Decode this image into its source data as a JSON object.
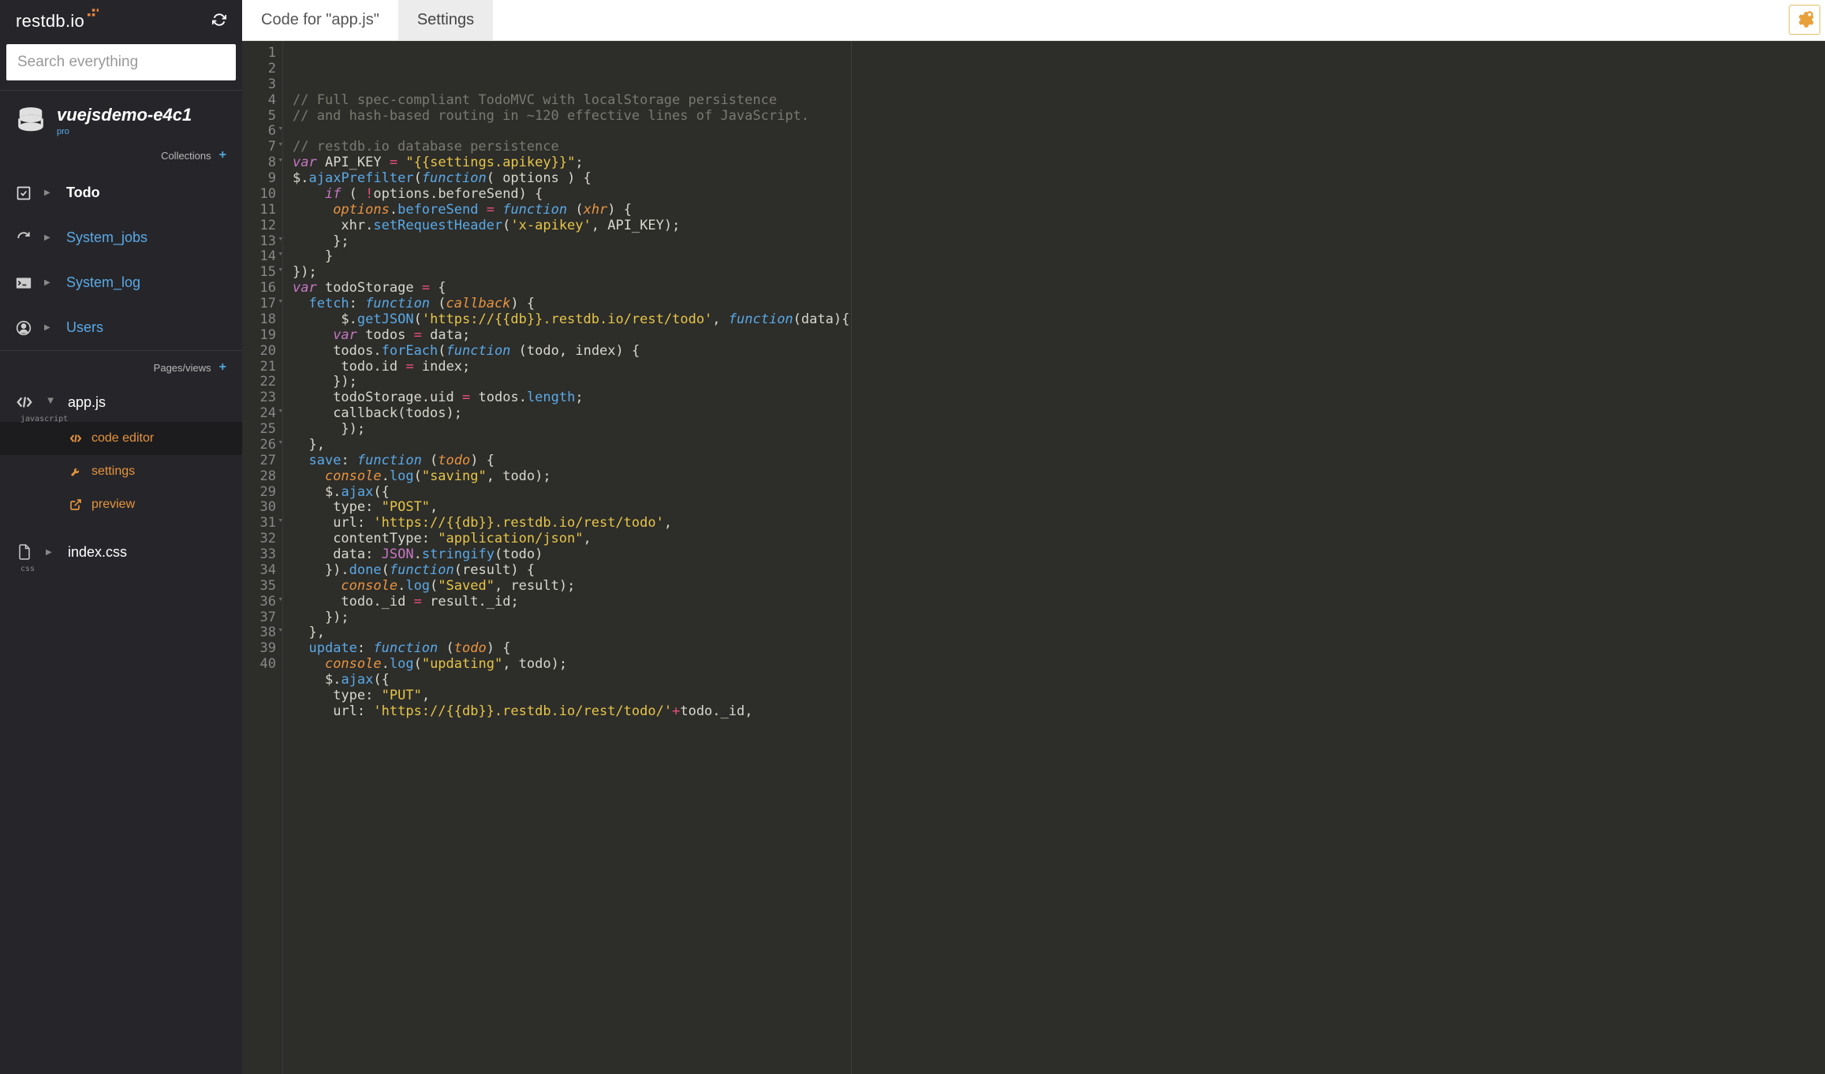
{
  "brand": "restdb.io",
  "search": {
    "placeholder": "Search everything"
  },
  "db": {
    "name": "vuejsdemo-e4c1",
    "plan": "pro"
  },
  "sections": {
    "collections": {
      "label": "Collections"
    },
    "pages": {
      "label": "Pages/views"
    }
  },
  "nav": {
    "todo": "Todo",
    "system_jobs": "System_jobs",
    "system_log": "System_log",
    "users": "Users"
  },
  "files": {
    "appjs": {
      "name": "app.js",
      "type": "javascript"
    },
    "indexcss": {
      "name": "index.css",
      "type": "css"
    }
  },
  "subitems": {
    "code_editor": "code editor",
    "settings": "settings",
    "preview": "preview"
  },
  "tabs": {
    "code": "Code for \"app.js\"",
    "settings": "Settings"
  },
  "editor": {
    "line_numbers": [
      "1",
      "2",
      "3",
      "4",
      "5",
      "6",
      "7",
      "8",
      "9",
      "10",
      "11",
      "12",
      "13",
      "14",
      "15",
      "16",
      "17",
      "18",
      "19",
      "20",
      "21",
      "22",
      "23",
      "24",
      "25",
      "26",
      "27",
      "28",
      "29",
      "30",
      "31",
      "32",
      "33",
      "34",
      "35",
      "36",
      "37",
      "38",
      "39",
      "40"
    ],
    "fold_lines": [
      6,
      7,
      8,
      13,
      14,
      15,
      17,
      24,
      26,
      31,
      36,
      38
    ],
    "lines_html": [
      "<span class='c-comment'>// Full spec-compliant TodoMVC with localStorage persistence</span>",
      "<span class='c-comment'>// and hash-based routing in ~120 effective lines of JavaScript.</span>",
      "",
      "<span class='c-comment'>// restdb.io database persistence</span>",
      "<span class='c-kw'>var</span> <span class='c-obj'>API_KEY</span> <span class='c-op'>=</span> <span class='c-str'>\"{{settings.apikey}}\"</span>;",
      "<span class='c-obj'>$</span>.<span class='c-method'>ajaxPrefilter</span>(<span class='c-func'>function</span>( <span class='c-obj'>options</span> ) {",
      "    <span class='c-kw'>if</span> ( <span class='c-op'>!</span><span class='c-obj'>options</span>.<span class='c-obj'>beforeSend</span>) {",
      "     <span class='c-param'>options</span>.<span class='c-method'>beforeSend</span> <span class='c-op'>=</span> <span class='c-func'>function</span> (<span class='c-param'>xhr</span>) {",
      "      <span class='c-obj'>xhr</span>.<span class='c-method'>setRequestHeader</span>(<span class='c-str'>'x-apikey'</span>, <span class='c-obj'>API_KEY</span>);",
      "     };",
      "    }",
      "});",
      "<span class='c-kw'>var</span> <span class='c-obj'>todoStorage</span> <span class='c-op'>=</span> {",
      "  <span class='c-prop'>fetch</span>: <span class='c-func'>function</span> (<span class='c-param'>callback</span>) {",
      "      <span class='c-obj'>$</span>.<span class='c-method'>getJSON</span>(<span class='c-str'>'https://{{db}}.restdb.io/rest/todo'</span>, <span class='c-func'>function</span>(<span class='c-obj'>data</span>){",
      "     <span class='c-kw'>var</span> <span class='c-obj'>todos</span> <span class='c-op'>=</span> <span class='c-obj'>data</span>;",
      "     <span class='c-obj'>todos</span>.<span class='c-method'>forEach</span>(<span class='c-func'>function</span> (<span class='c-obj'>todo</span>, <span class='c-obj'>index</span>) {",
      "      <span class='c-obj'>todo</span>.<span class='c-obj'>id</span> <span class='c-op'>=</span> <span class='c-obj'>index</span>;",
      "     });",
      "     <span class='c-obj'>todoStorage</span>.<span class='c-obj'>uid</span> <span class='c-op'>=</span> <span class='c-obj'>todos</span>.<span class='c-prop'>length</span>;",
      "     <span class='c-obj'>callback</span>(<span class='c-obj'>todos</span>);",
      "      });",
      "  },",
      "  <span class='c-prop'>save</span>: <span class='c-func'>function</span> (<span class='c-param'>todo</span>) {",
      "    <span class='c-param'>console</span>.<span class='c-method'>log</span>(<span class='c-str'>\"saving\"</span>, <span class='c-obj'>todo</span>);",
      "    <span class='c-obj'>$</span>.<span class='c-method'>ajax</span>({",
      "     <span class='c-obj'>type</span>: <span class='c-str'>\"POST\"</span>,",
      "     <span class='c-obj'>url</span>: <span class='c-str'>'https://{{db}}.restdb.io/rest/todo'</span>,",
      "     <span class='c-obj'>contentType</span>: <span class='c-str'>\"application/json\"</span>,",
      "     <span class='c-obj'>data</span>: <span class='c-const'>JSON</span>.<span class='c-method'>stringify</span>(<span class='c-obj'>todo</span>)",
      "    }).<span class='c-method'>done</span>(<span class='c-func'>function</span>(<span class='c-obj'>result</span>) {",
      "      <span class='c-param'>console</span>.<span class='c-method'>log</span>(<span class='c-str'>\"Saved\"</span>, <span class='c-obj'>result</span>);",
      "      <span class='c-obj'>todo</span>.<span class='c-obj'>_id</span> <span class='c-op'>=</span> <span class='c-obj'>result</span>.<span class='c-obj'>_id</span>;",
      "    });",
      "  },",
      "  <span class='c-prop'>update</span>: <span class='c-func'>function</span> (<span class='c-param'>todo</span>) {",
      "    <span class='c-param'>console</span>.<span class='c-method'>log</span>(<span class='c-str'>\"updating\"</span>, <span class='c-obj'>todo</span>);",
      "    <span class='c-obj'>$</span>.<span class='c-method'>ajax</span>({",
      "     <span class='c-obj'>type</span>: <span class='c-str'>\"PUT\"</span>,",
      "     <span class='c-obj'>url</span>: <span class='c-str'>'https://{{db}}.restdb.io/rest/todo/'</span><span class='c-op'>+</span><span class='c-obj'>todo</span>.<span class='c-obj'>_id</span>,"
    ]
  }
}
